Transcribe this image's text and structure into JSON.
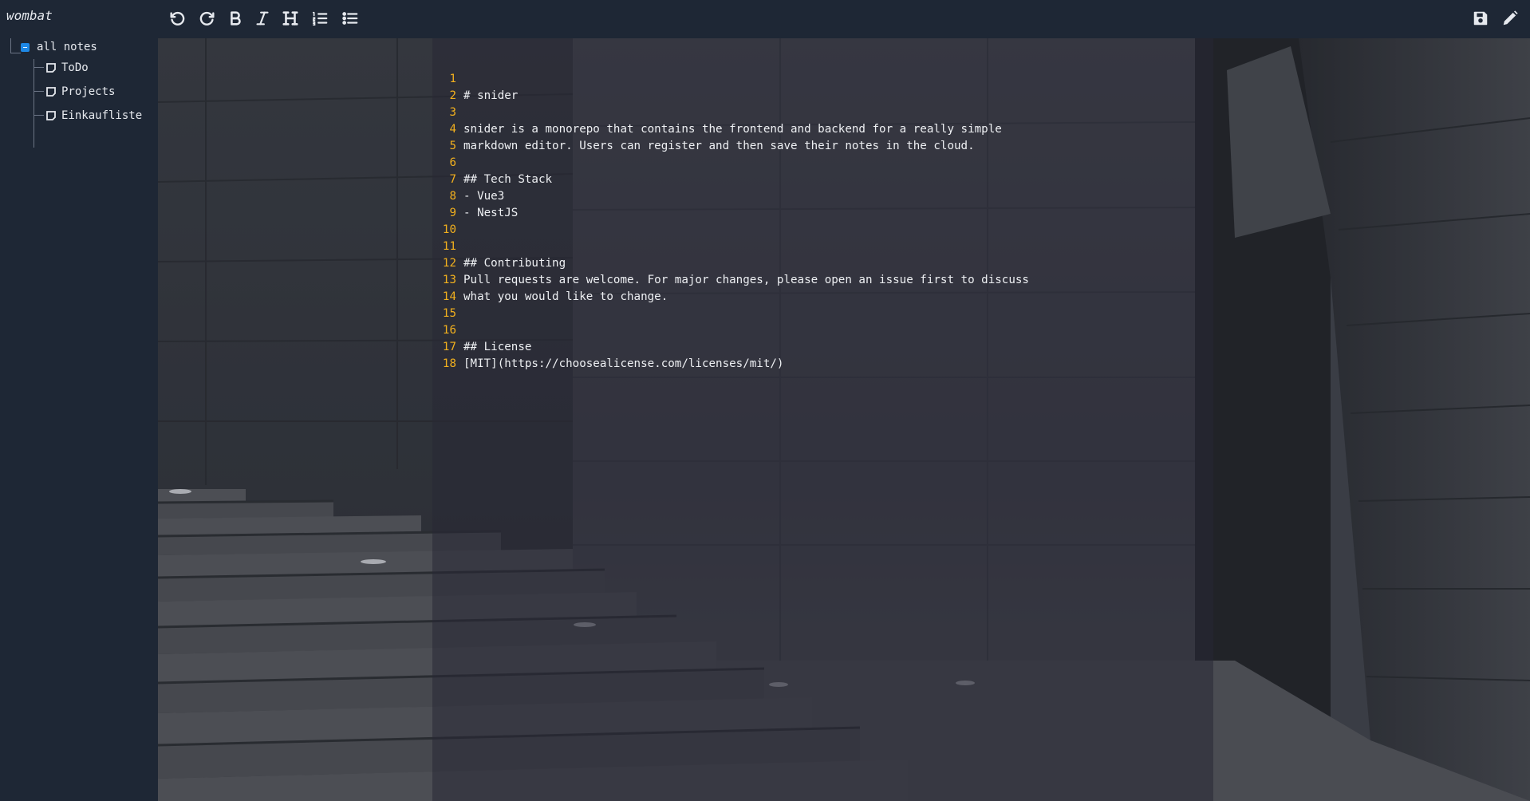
{
  "app": {
    "title": "wombat"
  },
  "toolbar": {
    "left_icons": [
      "undo-icon",
      "redo-icon",
      "bold-icon",
      "italic-icon",
      "heading-icon",
      "ordered-list-icon",
      "unordered-list-icon"
    ],
    "right_icons": [
      "save-icon",
      "pencil-icon"
    ]
  },
  "sidebar": {
    "root_label": "all notes",
    "notes": [
      {
        "label": "ToDo"
      },
      {
        "label": "Projects"
      },
      {
        "label": "Einkaufliste"
      }
    ]
  },
  "editor": {
    "line_numbers": [
      "1",
      "2",
      "3",
      "4",
      "5",
      "6",
      "7",
      "8",
      "9",
      "10",
      "11",
      "12",
      "13",
      "14",
      "15",
      "16",
      "17",
      "18"
    ],
    "lines": [
      "# snider",
      "",
      "snider is a monorepo that contains the frontend and backend for a really simple",
      "markdown editor. Users can register and then save their notes in the cloud.",
      "",
      "## Tech Stack",
      "- Vue3",
      "- NestJS",
      "",
      "",
      "## Contributing",
      "Pull requests are welcome. For major changes, please open an issue first to discuss",
      "what you would like to change.",
      "",
      "",
      "## License",
      "[MIT](https://choosealicense.com/licenses/mit/)",
      ""
    ]
  },
  "colors": {
    "sidebar_bg": "#1e2735",
    "line_number": "#f2b01e",
    "accent": "#1e88e5",
    "text": "#eef0f3"
  }
}
